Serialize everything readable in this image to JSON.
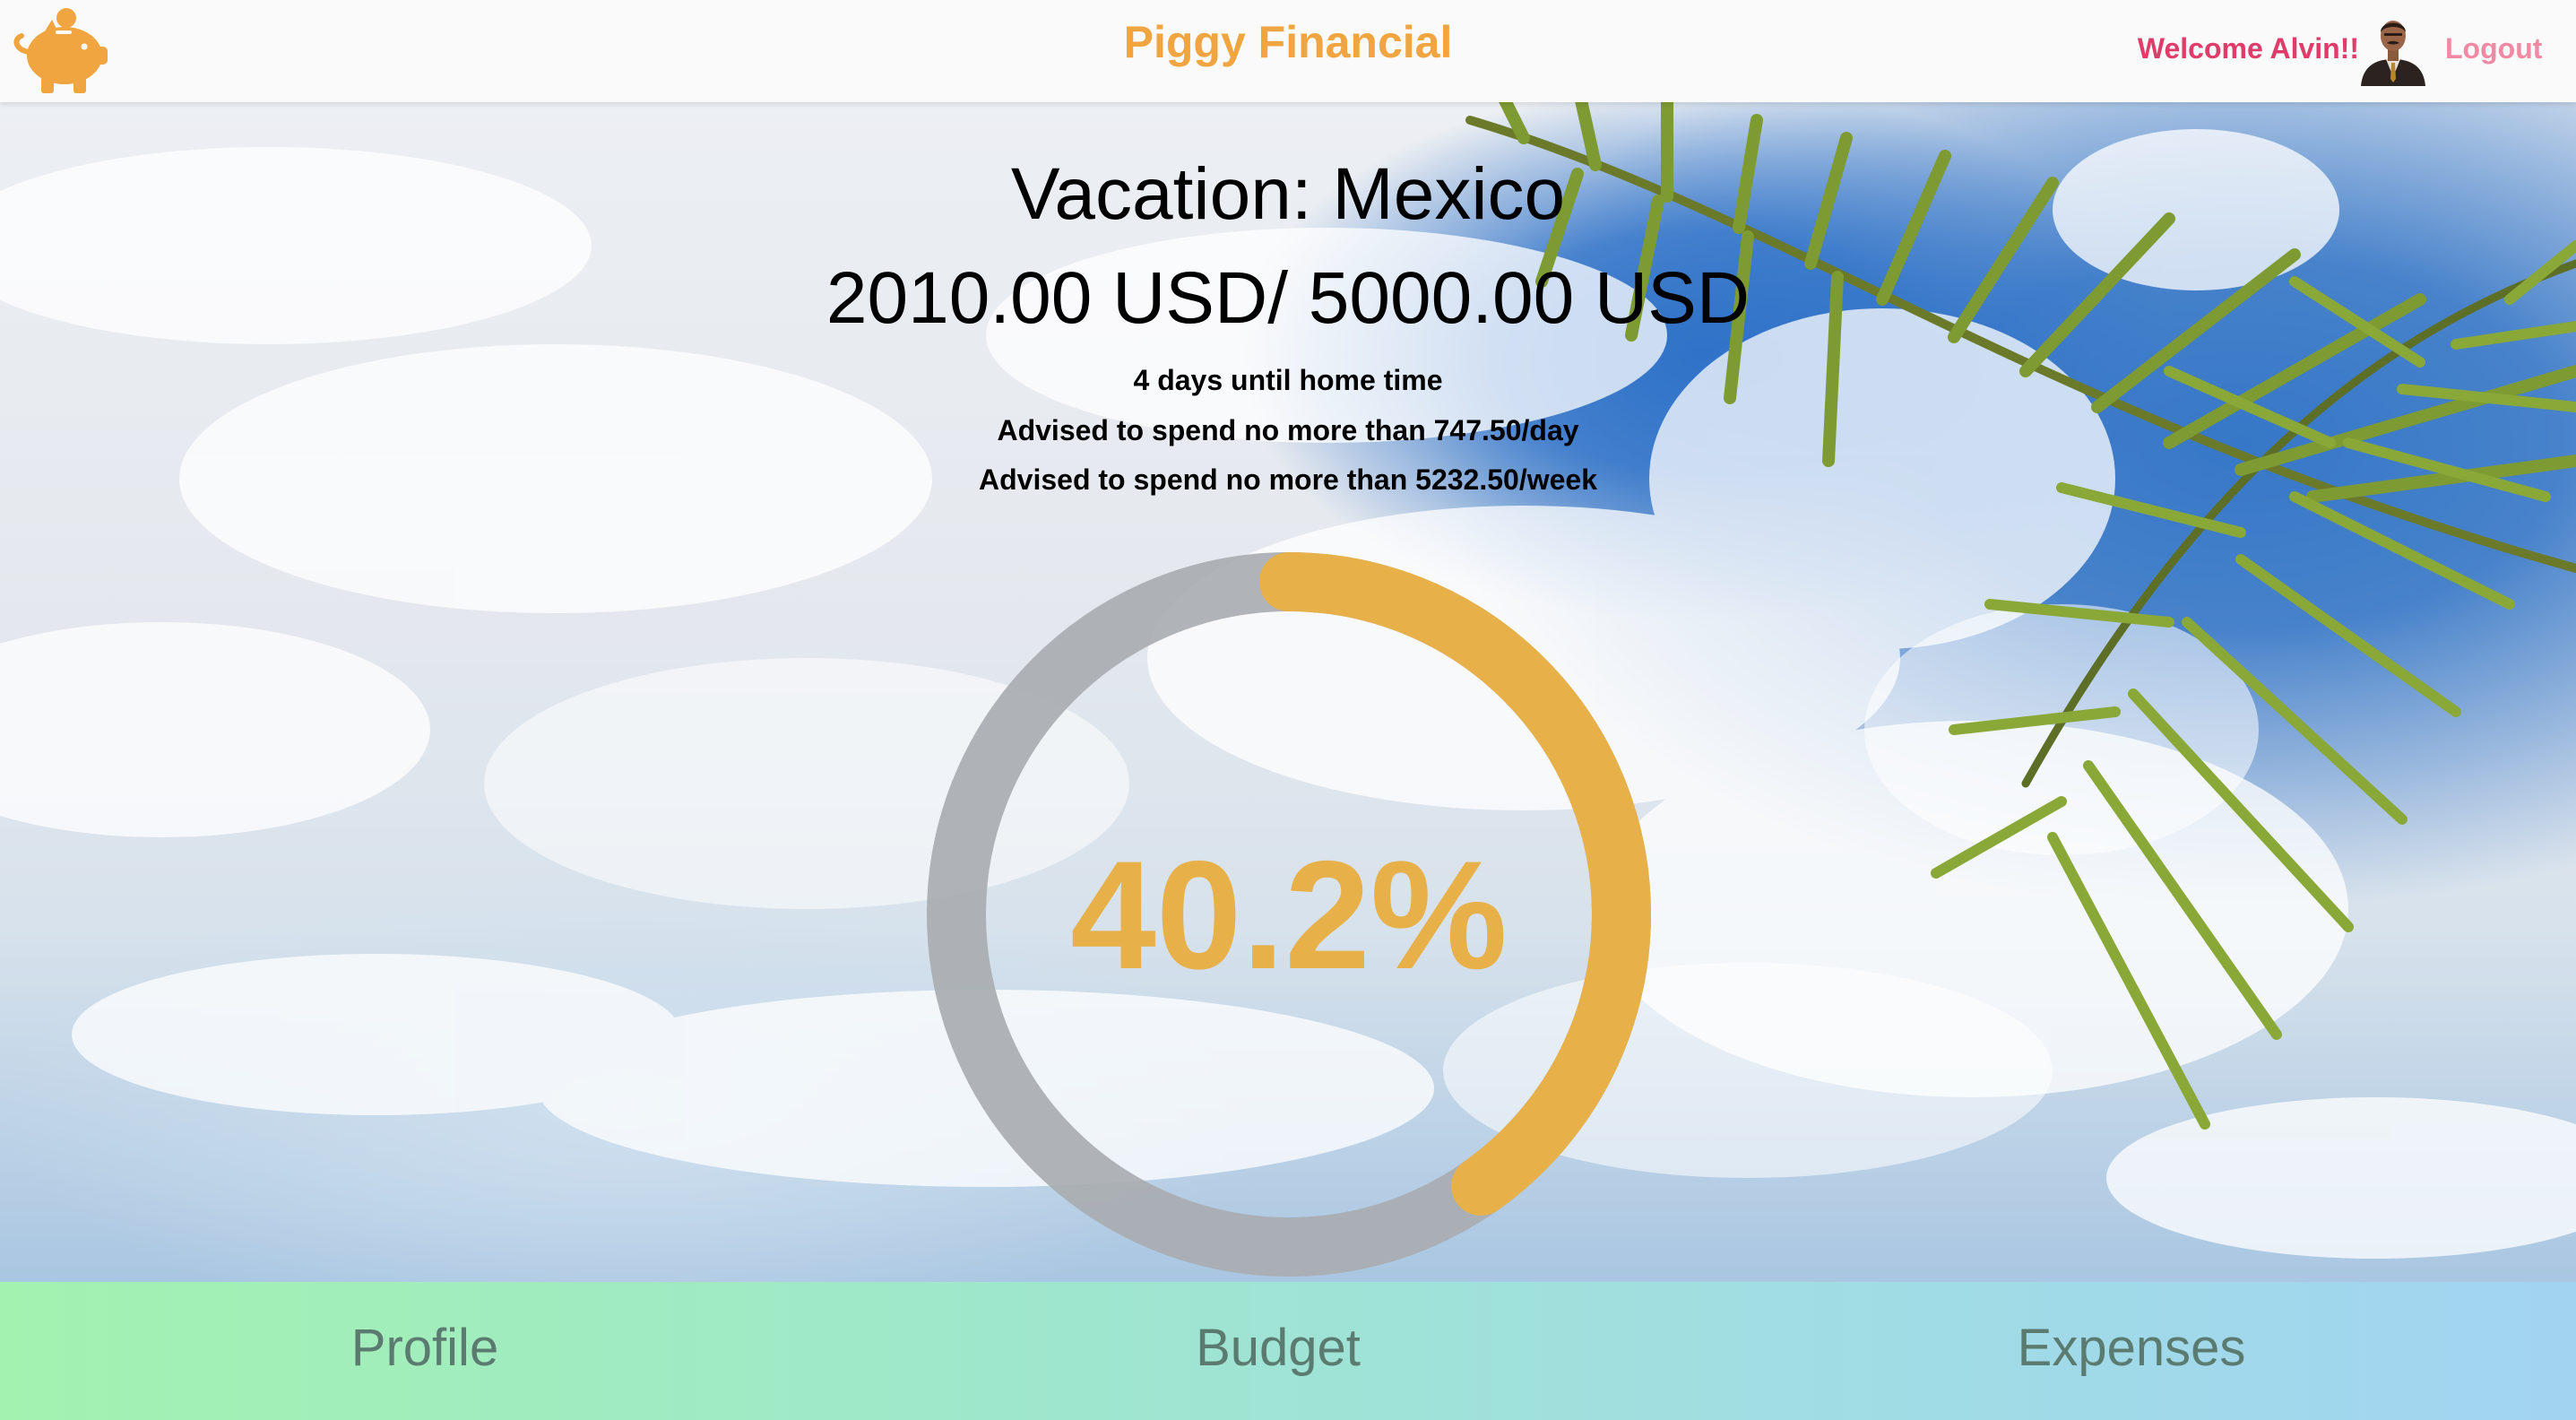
{
  "header": {
    "app_title": "Piggy Financial",
    "welcome_text": "Welcome Alvin!!",
    "logout_label": "Logout",
    "logo_icon": "piggy-bank-icon",
    "avatar_icon": "user-avatar"
  },
  "budget": {
    "title": "Vacation: Mexico",
    "amount_text": "2010.00 USD/ 5000.00 USD",
    "days_text": "4 days until home time",
    "daily_advice": "Advised to spend no more than 747.50/day",
    "weekly_advice": "Advised to spend no more than 5232.50/week",
    "percent_text": "40.2%",
    "progress_fraction": 0.402
  },
  "nav": {
    "profile_label": "Profile",
    "budget_label": "Budget",
    "expenses_label": "Expenses"
  },
  "colors": {
    "brand": "#f0a540",
    "progress": "#e8b048",
    "track": "#a9adb1",
    "welcome": "#e03c6a",
    "logout": "#f08aa4"
  }
}
